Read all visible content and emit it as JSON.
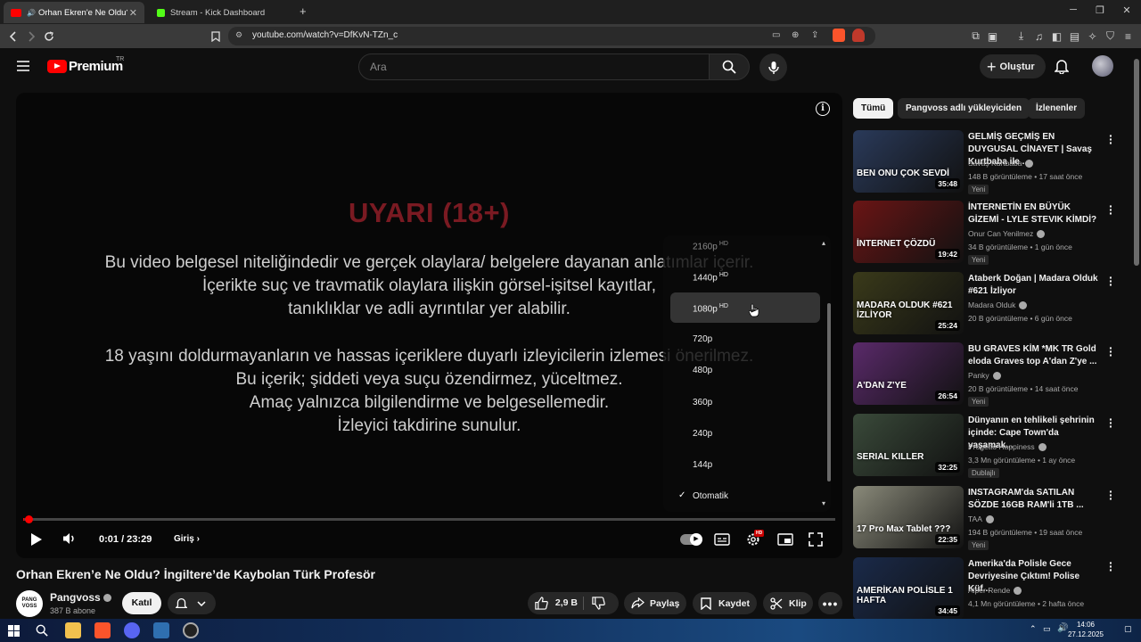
{
  "browser": {
    "tabs": [
      {
        "title": "Orhan Ekren'e Ne Oldu? İngilt",
        "active": true,
        "favicon_color": "#ff0000"
      },
      {
        "title": "Stream - Kick Dashboard",
        "active": false,
        "favicon_color": "#53fc18"
      }
    ],
    "url": "youtube.com/watch?v=DfKvN-TZn_c",
    "new_tab_label": "+"
  },
  "header": {
    "logo_text": "Premium",
    "logo_region": "TR",
    "search_placeholder": "Ara",
    "create_label": "Oluştur"
  },
  "player": {
    "warning_title": "UYARI (18+)",
    "warning_lines": [
      "Bu video belgesel niteliğindedir ve gerçek olaylara/ belgelere dayanan anlatımlar içerir.",
      "İçerikte suç ve travmatik olaylara ilişkin görsel-işitsel kayıtlar,",
      "tanıklıklar ve adli ayrıntılar yer alabilir.",
      "18 yaşını doldurmayanların ve hassas içeriklere duyarlı izleyicilerin izlemesi önerilmez.",
      "Bu içerik; şiddeti veya suçu özendirmez, yüceltmez.",
      "Amaç yalnızca bilgilendirme ve belgesellemedir.",
      "İzleyici takdirine sunulur."
    ],
    "time": "0:01 / 23:29",
    "chapter": "Giriş",
    "progress_fraction": 0.0007,
    "quality_menu": {
      "items": [
        {
          "label": "2160p",
          "badge": "HD"
        },
        {
          "label": "1440p",
          "badge": "HD"
        },
        {
          "label": "1080p",
          "badge": "HD"
        },
        {
          "label": "720p",
          "badge": ""
        },
        {
          "label": "480p",
          "badge": ""
        },
        {
          "label": "360p",
          "badge": ""
        },
        {
          "label": "240p",
          "badge": ""
        },
        {
          "label": "144p",
          "badge": ""
        },
        {
          "label": "Otomatik",
          "badge": ""
        }
      ],
      "selected": "Otomatik",
      "hovered": "1080p"
    }
  },
  "video": {
    "title": "Orhan Ekren’e Ne Oldu? İngiltere’de Kaybolan Türk Profesör",
    "channel": "Pangvoss",
    "channel_avatar_text": "PANG VOSS",
    "subscribers": "387 B abone",
    "join_label": "Katıl",
    "likes": "2,9 B",
    "share_label": "Paylaş",
    "save_label": "Kaydet",
    "clip_label": "Klip"
  },
  "sidebar": {
    "chips": [
      "Tümü",
      "Pangvoss adlı yükleyiciden",
      "İzlenenler"
    ],
    "recommendations": [
      {
        "title": "GELMİŞ GEÇMİŞ EN DUYGUSAL CİNAYET | Savaş Kurtbaba ile ...",
        "channel": "Savaş Kurtbaba",
        "meta": "148 B görüntüleme • 17 saat önce",
        "badge": "Yeni",
        "duration": "35:48",
        "caption": "BEN ONU ÇOK SEVDİ",
        "thumb_color": "#2a3a5a"
      },
      {
        "title": "İNTERNETİN EN BÜYÜK GİZEMİ - LYLE STEVIK KİMDİ?",
        "channel": "Onur Can Yenilmez",
        "meta": "34 B görüntüleme • 1 gün önce",
        "badge": "Yeni",
        "duration": "19:42",
        "caption": "İNTERNET ÇÖZDÜ",
        "thumb_color": "#6a1515"
      },
      {
        "title": "Ataberk Doğan | Madara Olduk #621 İzliyor",
        "channel": "Madara Olduk",
        "meta": "20 B görüntüleme • 6 gün önce",
        "badge": "",
        "duration": "25:24",
        "caption": "MADARA OLDUK #621 İZLİYOR",
        "thumb_color": "#3a3a1a"
      },
      {
        "title": "BU GRAVES KİM *MK TR Gold eloda Graves top A'dan Z'ye ...",
        "channel": "Panky",
        "meta": "20 B görüntüleme • 14 saat önce",
        "badge": "Yeni",
        "duration": "26:54",
        "caption": "A'DAN Z'YE",
        "thumb_color": "#5a2a6a"
      },
      {
        "title": "Dünyanın en tehlikeli şehrinin içinde: Cape Town'da yaşamak...",
        "channel": "Progetto Happiness",
        "meta": "3,3 Mn görüntüleme • 1 ay önce",
        "badge": "Dublajlı",
        "duration": "32:25",
        "caption": "SERIAL KILLER",
        "thumb_color": "#3a4a3a"
      },
      {
        "title": "INSTAGRAM'da SATILAN SÖZDE 16GB RAM'li 1TB ...",
        "channel": "TAA",
        "meta": "194 B görüntüleme • 19 saat önce",
        "badge": "Yeni",
        "duration": "22:35",
        "caption": "17 Pro Max Tablet ???",
        "thumb_color": "#8a8a7a"
      },
      {
        "title": "Amerika'da Polisle Gece Devriyesine Çıktım! Polise Küf...",
        "channel": "Alper Rende",
        "meta": "4,1 Mn görüntüleme • 2 hafta önce",
        "badge": "",
        "duration": "34:45",
        "caption": "AMERİKAN POLİSLE 1 HAFTA",
        "thumb_color": "#1a2a4a"
      }
    ]
  },
  "taskbar": {
    "time": "14:06",
    "date": "27.12.2025"
  }
}
